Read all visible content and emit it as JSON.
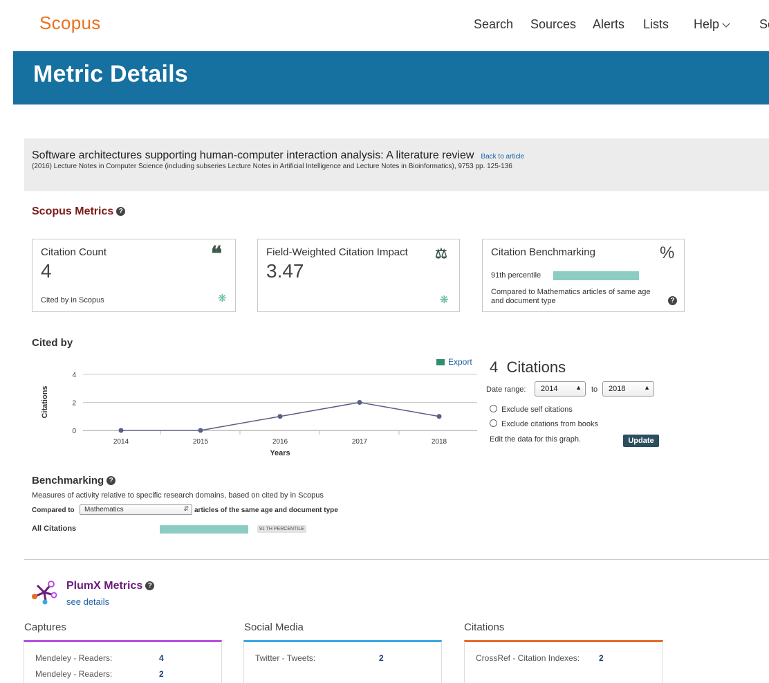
{
  "header": {
    "logo": "Scopus",
    "nav": [
      "Search",
      "Sources",
      "Alerts",
      "Lists",
      "Help",
      "Sc"
    ]
  },
  "banner": {
    "title": "Metric Details"
  },
  "article": {
    "title": "Software architectures supporting human-computer interaction analysis: A literature review",
    "back_link": "Back to article",
    "citation": "(2016) Lecture Notes in Computer Science (including subseries Lecture Notes in Artificial Intelligence and Lecture Notes in Bioinformatics), 9753 pp. 125-136"
  },
  "metrics": {
    "heading": "Scopus Metrics",
    "help": "?",
    "citation_count": {
      "title": "Citation Count",
      "value": "4",
      "foot": "Cited by in Scopus"
    },
    "fwci": {
      "title": "Field-Weighted Citation Impact",
      "value": "3.47"
    },
    "benchmark": {
      "title": "Citation Benchmarking",
      "symbol": "%",
      "percentile": "91th percentile",
      "percentile_value": 91,
      "note_line1": "Compared to Mathematics articles of same age",
      "note_line2": "and document type"
    }
  },
  "cited_by": {
    "heading": "Cited by",
    "export": "Export",
    "citations_count": "4",
    "citations_label": "Citations",
    "date_range_label": "Date range:",
    "from": "2014",
    "to_label": "to",
    "to": "2018",
    "exclude_self": "Exclude self citations",
    "exclude_books": "Exclude citations from books",
    "edit_note": "Edit the data for this graph.",
    "update": "Update"
  },
  "chart_data": {
    "type": "line",
    "x": [
      "2014",
      "2015",
      "2016",
      "2017",
      "2018"
    ],
    "series": [
      {
        "values": [
          0,
          0,
          1,
          2,
          1
        ]
      }
    ],
    "xlabel": "Years",
    "ylabel": "Citations",
    "ylim": [
      0,
      4
    ],
    "yticks": [
      "0",
      "2",
      "4"
    ],
    "grid": true,
    "color": "#5a5f85"
  },
  "benchmarking": {
    "heading": "Benchmarking",
    "description": "Measures of activity relative to specific research domains, based on cited by in Scopus",
    "compared_to": "Compared to",
    "domain": "Mathematics",
    "suffix": "articles of the same age and document type",
    "row_label": "All Citations",
    "percentile_tag": "91 TH PERCENTILE",
    "percentile_value": 91
  },
  "plumx": {
    "title": "PlumX Metrics",
    "see_details": "see details",
    "columns": [
      {
        "name": "Captures",
        "color": "#b64ee0",
        "rows": [
          {
            "label": "Mendeley - Readers:",
            "value": "4"
          },
          {
            "label": "Mendeley - Readers:",
            "value": "2"
          }
        ]
      },
      {
        "name": "Social Media",
        "color": "#39a7e2",
        "rows": [
          {
            "label": "Twitter - Tweets:",
            "value": "2"
          }
        ]
      },
      {
        "name": "Citations",
        "color": "#e86a2b",
        "rows": [
          {
            "label": "CrossRef - Citation Indexes:",
            "value": "2"
          }
        ]
      }
    ]
  }
}
